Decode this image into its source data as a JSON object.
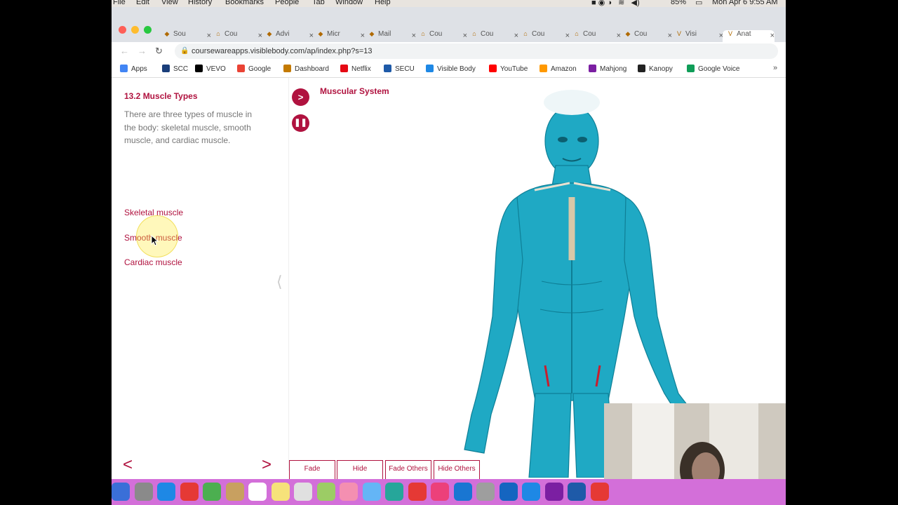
{
  "menubar": {
    "items": [
      "File",
      "Edit",
      "View",
      "History",
      "Bookmarks",
      "People",
      "Tab",
      "Window",
      "Help"
    ],
    "battery": "85%",
    "clock": "Mon Apr 6  9:55 AM"
  },
  "tabs": [
    {
      "label": "Sou",
      "icon": "app-icon"
    },
    {
      "label": "Cou",
      "icon": "house-icon"
    },
    {
      "label": "Advi",
      "icon": "app-icon"
    },
    {
      "label": "Micr",
      "icon": "office-icon"
    },
    {
      "label": "Mail",
      "icon": "outlook-icon"
    },
    {
      "label": "Cou",
      "icon": "house-icon"
    },
    {
      "label": "Cou",
      "icon": "house-icon"
    },
    {
      "label": "Cou",
      "icon": "house-icon"
    },
    {
      "label": "Cou",
      "icon": "house-icon"
    },
    {
      "label": "Cou",
      "icon": "doc-icon"
    },
    {
      "label": "Visi",
      "icon": "vb-icon"
    },
    {
      "label": "Anat",
      "icon": "vb-icon",
      "active": true
    }
  ],
  "address": {
    "url": "coursewareapps.visiblebody.com/ap/index.php?s=13"
  },
  "bookmarks": [
    {
      "label": "Apps",
      "icon": "grid-icon",
      "color": "#4285f4"
    },
    {
      "label": "SCC",
      "icon": "app-icon",
      "color": "#1a3e7a"
    },
    {
      "label": "VEVO",
      "icon": "vevo-icon",
      "color": "#000000"
    },
    {
      "label": "Google",
      "icon": "google-icon",
      "color": "#ea4335"
    },
    {
      "label": "Dashboard",
      "icon": "house-icon",
      "color": "#c47a00"
    },
    {
      "label": "Netflix",
      "icon": "netflix-icon",
      "color": "#e50914"
    },
    {
      "label": "SECU",
      "icon": "secu-icon",
      "color": "#1e5aa8"
    },
    {
      "label": "Visible Body",
      "icon": "vb-icon",
      "color": "#1e88e5"
    },
    {
      "label": "YouTube",
      "icon": "youtube-icon",
      "color": "#ff0000"
    },
    {
      "label": "Amazon",
      "icon": "amazon-icon",
      "color": "#ff9900"
    },
    {
      "label": "Mahjong",
      "icon": "mahjong-icon",
      "color": "#7b1fa2"
    },
    {
      "label": "Kanopy",
      "icon": "kanopy-icon",
      "color": "#222222"
    },
    {
      "label": "Google Voice",
      "icon": "voice-icon",
      "color": "#0f9d58"
    }
  ],
  "lesson": {
    "title": "13.2 Muscle Types",
    "description": "There are three types of muscle in the body: skeletal muscle, smooth muscle, and cardiac muscle.",
    "links": [
      "Skeletal muscle",
      "Smooth muscle",
      "Cardiac muscle"
    ]
  },
  "viewer": {
    "system_title": "Muscular System",
    "toolbar": [
      {
        "label": "Fade"
      },
      {
        "label": "Hide"
      },
      {
        "label": "Fade Others"
      },
      {
        "label": "Hide Others"
      }
    ]
  },
  "colors": {
    "accent": "#b0123f",
    "muscle": "#1fa9c4",
    "dock": "#d36fd9"
  }
}
